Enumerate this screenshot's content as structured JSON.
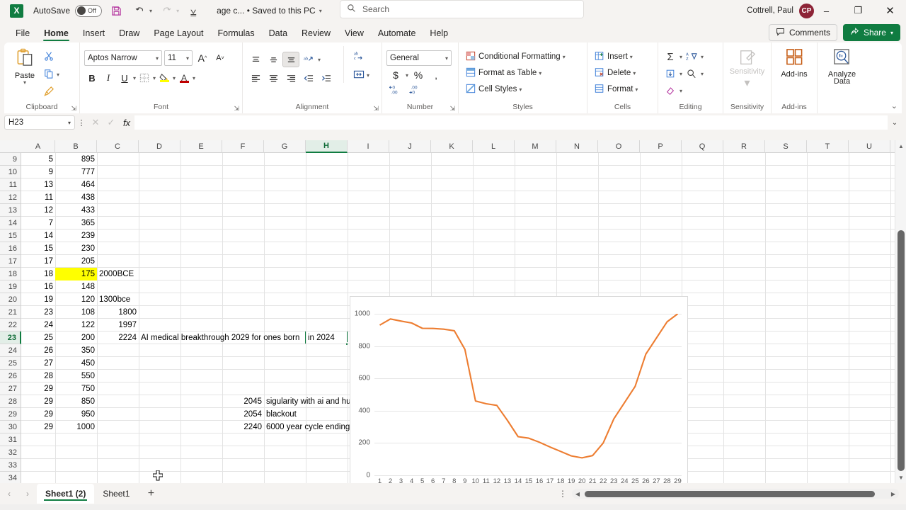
{
  "titlebar": {
    "app_icon": "excel-logo",
    "autosave_label": "AutoSave",
    "autosave_state": "Off",
    "save_icon": "save-icon",
    "undo_icon": "undo-icon",
    "redo_icon": "redo-icon",
    "customize_icon": "customize-quick-access-icon",
    "document_title": "age c... • Saved to this PC",
    "search_placeholder": "Search",
    "search_icon": "search-icon",
    "user_name": "Cottrell, Paul",
    "user_initials": "CP",
    "minimize": "–",
    "restore": "❐",
    "close": "✕"
  },
  "ribbon_tabs": [
    {
      "label": "File",
      "active": false
    },
    {
      "label": "Home",
      "active": true
    },
    {
      "label": "Insert",
      "active": false
    },
    {
      "label": "Draw",
      "active": false
    },
    {
      "label": "Page Layout",
      "active": false
    },
    {
      "label": "Formulas",
      "active": false
    },
    {
      "label": "Data",
      "active": false
    },
    {
      "label": "Review",
      "active": false
    },
    {
      "label": "View",
      "active": false
    },
    {
      "label": "Automate",
      "active": false
    },
    {
      "label": "Help",
      "active": false
    }
  ],
  "tabstrip_right": {
    "comments_label": "Comments",
    "comments_icon": "comment-icon",
    "share_label": "Share",
    "share_icon": "share-icon"
  },
  "ribbon": {
    "clipboard": {
      "group_label": "Clipboard",
      "paste_label": "Paste",
      "cut_label": "Cut",
      "copy_label": "Copy",
      "format_painter_label": "Format Painter"
    },
    "font": {
      "group_label": "Font",
      "font_name": "Aptos Narrow",
      "font_size": "11",
      "grow_font": "A",
      "shrink_font": "A",
      "bold": "B",
      "italic": "I",
      "underline": "U",
      "borders_label": "Borders",
      "fill_color_label": "Fill Color",
      "font_color_label": "Font Color",
      "fill_color_hex": "#ffff00",
      "font_color_hex": "#c00000"
    },
    "alignment": {
      "group_label": "Alignment",
      "top_align": "Top Align",
      "middle_align": "Middle Align",
      "bottom_align": "Bottom Align",
      "orientation": "Orientation",
      "align_left": "Align Left",
      "center": "Center",
      "align_right": "Align Right",
      "decrease_indent": "Decrease Indent",
      "increase_indent": "Increase Indent",
      "wrap_text": "Wrap Text",
      "merge_cells": "Merge & Center"
    },
    "number": {
      "group_label": "Number",
      "format": "General",
      "accounting": "$",
      "percent": "%",
      "comma": "‚",
      "increase_decimal": "Increase Decimal",
      "decrease_decimal": "Decrease Decimal"
    },
    "styles": {
      "group_label": "Styles",
      "conditional_formatting": "Conditional Formatting",
      "format_as_table": "Format as Table",
      "cell_styles": "Cell Styles"
    },
    "cells": {
      "group_label": "Cells",
      "insert": "Insert",
      "delete": "Delete",
      "format": "Format"
    },
    "editing": {
      "group_label": "Editing",
      "autosum": "Σ",
      "sort_filter": "Sort & Filter",
      "fill": "Fill",
      "find_select": "Find & Select",
      "clear": "Clear"
    },
    "sensitivity": {
      "group_label": "Sensitivity",
      "button_label": "Sensitivity"
    },
    "addins": {
      "group_label": "Add-ins",
      "button_label": "Add-ins"
    },
    "analyze": {
      "group_label": "",
      "button_label_1": "Analyze",
      "button_label_2": "Data"
    },
    "collapse_icon": "chevron-down-icon"
  },
  "formulabar": {
    "name_box": "H23",
    "cancel_icon": "cancel-icon",
    "enter_icon": "enter-icon",
    "function_icon": "fx",
    "formula_value": "",
    "expand_icon": "chevron-down-icon"
  },
  "grid": {
    "columns": [
      "A",
      "B",
      "C",
      "D",
      "E",
      "F",
      "G",
      "H",
      "I",
      "J",
      "K",
      "L",
      "M",
      "N",
      "O",
      "P",
      "Q",
      "R",
      "S",
      "T",
      "U"
    ],
    "selected_column": "H",
    "selected_row": "23",
    "selected_cell": "H23",
    "rows": [
      {
        "num": "9",
        "A": "5",
        "B": "895",
        "C": "",
        "D": "",
        "H": ""
      },
      {
        "num": "10",
        "A": "9",
        "B": "777",
        "C": "",
        "D": "",
        "H": ""
      },
      {
        "num": "11",
        "A": "13",
        "B": "464",
        "C": "",
        "D": "",
        "H": ""
      },
      {
        "num": "12",
        "A": "11",
        "B": "438",
        "C": "",
        "D": "",
        "H": ""
      },
      {
        "num": "13",
        "A": "12",
        "B": "433",
        "C": "",
        "D": "",
        "H": ""
      },
      {
        "num": "14",
        "A": "7",
        "B": "365",
        "C": "",
        "D": "",
        "H": ""
      },
      {
        "num": "15",
        "A": "14",
        "B": "239",
        "C": "",
        "D": "",
        "H": ""
      },
      {
        "num": "16",
        "A": "15",
        "B": "230",
        "C": "",
        "D": "",
        "H": ""
      },
      {
        "num": "17",
        "A": "17",
        "B": "205",
        "C": "",
        "D": "",
        "H": ""
      },
      {
        "num": "18",
        "A": "18",
        "B": "175",
        "C": "2000BCE",
        "D": "",
        "H": "",
        "B_highlight": true
      },
      {
        "num": "19",
        "A": "16",
        "B": "148",
        "C": "",
        "D": "",
        "H": ""
      },
      {
        "num": "20",
        "A": "19",
        "B": "120",
        "C": "1300bce",
        "D": "",
        "H": ""
      },
      {
        "num": "21",
        "A": "23",
        "B": "108",
        "C": "1800",
        "D": "",
        "H": ""
      },
      {
        "num": "22",
        "A": "24",
        "B": "122",
        "C": "1997",
        "D": "",
        "H": ""
      },
      {
        "num": "23",
        "A": "25",
        "B": "200",
        "C": "2224",
        "D": "AI medical breakthrough 2029 for ones born",
        "H": "in 2024"
      },
      {
        "num": "24",
        "A": "26",
        "B": "350",
        "C": "",
        "D": "",
        "H": ""
      },
      {
        "num": "25",
        "A": "27",
        "B": "450",
        "C": "",
        "D": "",
        "H": ""
      },
      {
        "num": "26",
        "A": "28",
        "B": "550",
        "C": "",
        "D": "",
        "H": ""
      },
      {
        "num": "27",
        "A": "29",
        "B": "750",
        "C": "",
        "D": "",
        "H": ""
      },
      {
        "num": "28",
        "A": "29",
        "B": "850",
        "C": "",
        "D": "",
        "H": "",
        "F": "2045",
        "G": "sigularity with ai and humans"
      },
      {
        "num": "29",
        "A": "29",
        "B": "950",
        "C": "",
        "D": "",
        "H": "",
        "F": "2054",
        "G": "blackout"
      },
      {
        "num": "30",
        "A": "29",
        "B": "1000",
        "C": "",
        "D": "",
        "H": "",
        "F": "2240",
        "G": "6000 year cycle ending"
      },
      {
        "num": "31",
        "A": "",
        "B": "",
        "C": "",
        "D": "",
        "H": ""
      },
      {
        "num": "32",
        "A": "",
        "B": "",
        "C": "",
        "D": "",
        "H": ""
      },
      {
        "num": "33",
        "A": "",
        "B": "",
        "C": "",
        "D": "",
        "H": ""
      },
      {
        "num": "34",
        "A": "",
        "B": "",
        "C": "",
        "D": "",
        "H": ""
      }
    ]
  },
  "chart_data": {
    "type": "line",
    "title": "",
    "xlabel": "",
    "ylabel": "",
    "ylim": [
      0,
      1000
    ],
    "yticks": [
      0,
      200,
      400,
      600,
      800,
      1000
    ],
    "grid": true,
    "legend": false,
    "line_color": "#ed7d31",
    "categories": [
      "1",
      "2",
      "3",
      "4",
      "5",
      "6",
      "7",
      "8",
      "9",
      "10",
      "11",
      "12",
      "13",
      "14",
      "15",
      "16",
      "17",
      "18",
      "19",
      "20",
      "21",
      "22",
      "23",
      "24",
      "25",
      "26",
      "27",
      "28",
      "29"
    ],
    "values": [
      930,
      968,
      955,
      943,
      910,
      909,
      905,
      895,
      780,
      460,
      443,
      433,
      340,
      239,
      230,
      205,
      175,
      148,
      120,
      108,
      122,
      200,
      350,
      450,
      550,
      750,
      850,
      950,
      1000
    ]
  },
  "sheetbar": {
    "prev_icon": "chevron-left-icon",
    "next_icon": "chevron-right-icon",
    "tabs": [
      {
        "label": "Sheet1 (2)",
        "active": true
      },
      {
        "label": "Sheet1",
        "active": false
      }
    ],
    "add_sheet": "+",
    "kebab_icon": "more-options-icon"
  },
  "colors": {
    "excel_green": "#107c41",
    "chart_orange": "#ed7d31",
    "highlight_yellow": "#ffff00"
  }
}
